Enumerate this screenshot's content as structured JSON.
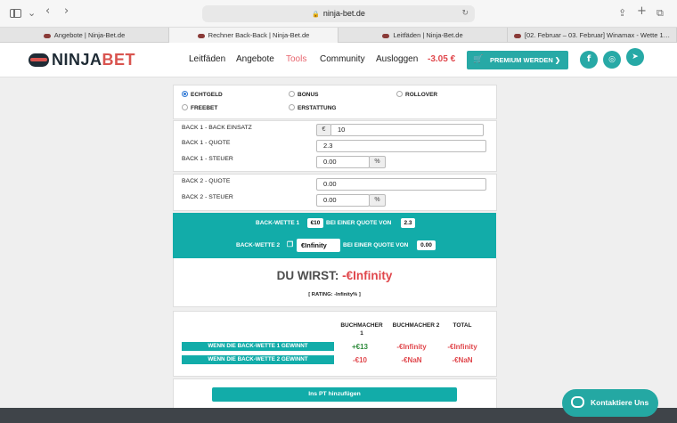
{
  "browser": {
    "url": "ninja-bet.de",
    "tabs": [
      {
        "label": "Angebote | Ninja-Bet.de",
        "active": false
      },
      {
        "label": "Rechner Back-Back | Ninja-Bet.de",
        "active": true
      },
      {
        "label": "Leitfäden | Ninja-Bet.de",
        "active": false
      },
      {
        "label": "[02. Februar – 03. Februar] Winamax - Wette 1…",
        "active": false
      }
    ]
  },
  "header": {
    "logo_ninja": "NINJA",
    "logo_bet": "BET",
    "nav": [
      "Leitfäden",
      "Angebote",
      "Tools",
      "Community",
      "Ausloggen"
    ],
    "active_nav": "Tools",
    "balance": "-3.05 €",
    "premium_label": "PREMIUM WERDEN ❯",
    "social_icons": [
      "facebook-icon",
      "instagram-icon",
      "telegram-icon"
    ]
  },
  "mode": {
    "options": [
      "ECHTGELD",
      "BONUS",
      "ROLLOVER",
      "FREEBET",
      "ERSTATTUNG"
    ],
    "selected": "ECHTGELD"
  },
  "back1": {
    "stake_label": "BACK 1 - BACK EINSATZ",
    "currency": "€",
    "stake_value": "10",
    "odds_label": "BACK 1 - QUOTE",
    "odds_value": "2.3",
    "tax_label": "BACK 1 - STEUER",
    "tax_value": "0.00",
    "tax_unit": "%"
  },
  "back2": {
    "odds_label": "BACK 2 - QUOTE",
    "odds_value": "0.00",
    "tax_label": "BACK 2 - STEUER",
    "tax_value": "0.00",
    "tax_unit": "%"
  },
  "summary": {
    "line1_prefix": "BACK-WETTE 1",
    "line1_stake": "€10",
    "line1_mid": "BEI EINER QUOTE VON",
    "line1_odds": "2.3",
    "line2_prefix": "BACK-WETTE 2",
    "line2_stake": "€Infinity",
    "line2_mid": "BEI EINER QUOTE VON",
    "line2_odds": "0.00"
  },
  "result": {
    "title_prefix": "DU WIRST:",
    "title_value": "-€Infinity",
    "rating": "[ RATING: -Infinity% ]"
  },
  "table": {
    "headers": [
      "BUCHMACHER 1",
      "BUCHMACHER 2",
      "TOTAL"
    ],
    "rows": [
      {
        "label": "WENN DIE BACK-WETTE 1 GEWINNT",
        "values": [
          "+€13",
          "-€Infinity",
          "-€Infinity"
        ]
      },
      {
        "label": "WENN DIE BACK-WETTE 2 GEWINNT",
        "values": [
          "-€10",
          "-€NaN",
          "-€NaN"
        ]
      }
    ]
  },
  "add_pt_label": "Ins PT hinzufügen",
  "contact_label": "Kontaktiere Uns",
  "colors": {
    "teal": "#12aca9",
    "accent_red": "#e0474c",
    "positive_green": "#2c8a3a"
  }
}
